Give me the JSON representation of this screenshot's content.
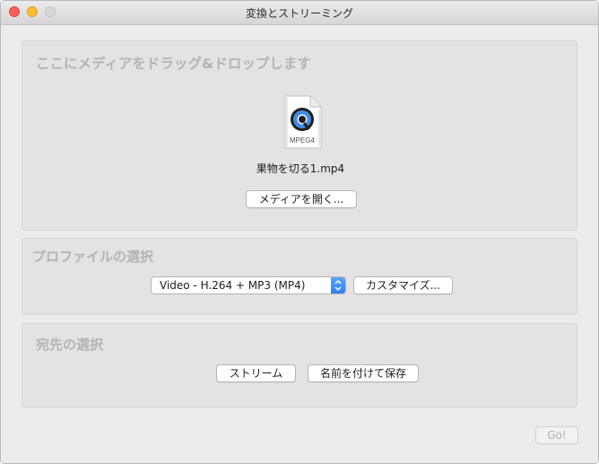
{
  "window": {
    "title": "変換とストリーミング"
  },
  "media": {
    "heading": "ここにメディアをドラッグ&ドロップします",
    "file_icon_label": "MPEG4",
    "file_name": "果物を切る1.mp4",
    "open_button": "メディアを開く..."
  },
  "profile": {
    "heading": "プロファイルの選択",
    "selected": "Video - H.264 + MP3 (MP4)",
    "customize_button": "カスタマイズ..."
  },
  "destination": {
    "heading": "宛先の選択",
    "stream_button": "ストリーム",
    "save_button": "名前を付けて保存"
  },
  "footer": {
    "go_button": "Go!"
  },
  "colors": {
    "accent": "#2f7ff3",
    "close": "#fc5f57",
    "minimize": "#fdbc2e"
  }
}
